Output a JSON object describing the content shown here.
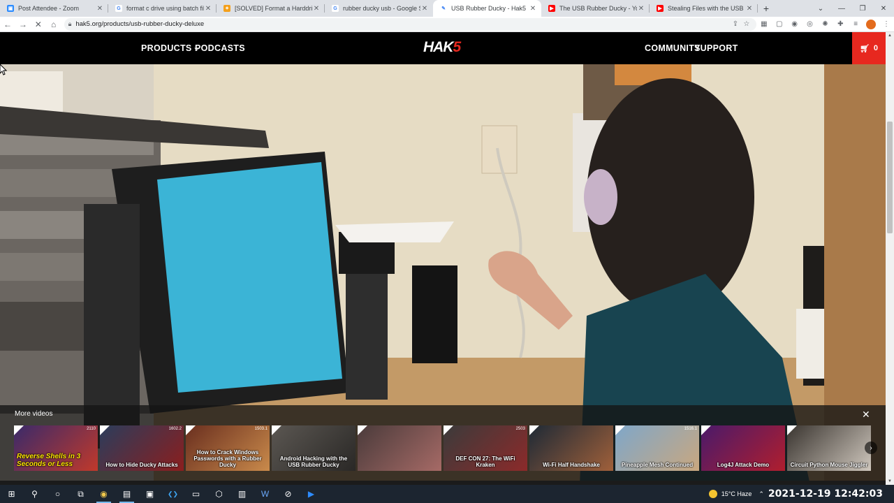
{
  "browser": {
    "tabs": [
      {
        "title": "Post Attendee - Zoom",
        "fav_color": "#2d8cff",
        "fav_glyph": "▣",
        "icon": "zoom-icon"
      },
      {
        "title": "format c drive using batch file -",
        "fav_color": "#ffffff",
        "fav_glyph": "G",
        "icon": "google-icon"
      },
      {
        "title": "[SOLVED] Format a Harddrive us",
        "fav_color": "#f4a01c",
        "fav_glyph": "✦",
        "icon": "spiceworks-icon"
      },
      {
        "title": "rubber ducky usb - Google Sear",
        "fav_color": "#ffffff",
        "fav_glyph": "G",
        "icon": "google-icon"
      },
      {
        "title": "USB Rubber Ducky - Hak5",
        "fav_color": "#ffffff",
        "fav_glyph": "✎",
        "icon": "hak5-icon",
        "active": true
      },
      {
        "title": "The USB Rubber Ducky - YouTu",
        "fav_color": "#ff0000",
        "fav_glyph": "▶",
        "icon": "youtube-icon"
      },
      {
        "title": "Stealing Files with the USB Rub",
        "fav_color": "#ff0000",
        "fav_glyph": "▶",
        "icon": "youtube-icon"
      }
    ],
    "new_tab": "+",
    "url": "hak5.org/products/usb-rubber-ducky-deluxe"
  },
  "site": {
    "nav_left": [
      "PRODUCTS",
      "PODCASTS"
    ],
    "products_caret": "⌵",
    "logo_pre": "HAK",
    "logo_num": "5",
    "nav_right": [
      "COMMUNITY",
      "SUPPORT"
    ],
    "cart_count": "0",
    "colors": {
      "accent": "#e7281f",
      "header_bg": "#000000"
    }
  },
  "more_videos": {
    "title": "More videos",
    "close": "✕",
    "items": [
      {
        "caption": "Reverse Shells in 3 Seconds or Less",
        "bg": "#3a2a6a",
        "bg2": "#c0392b",
        "num": "2110",
        "style": "big"
      },
      {
        "caption": "How to Hide Ducky Attacks",
        "bg": "#2b3d5c",
        "bg2": "#8b1e1e",
        "num": "1602.2"
      },
      {
        "caption": "How to Crack Windows Passwords with a Rubber Ducky",
        "bg": "#6a2f1f",
        "bg2": "#c98a4b",
        "num": "1503.1"
      },
      {
        "caption": "Android Hacking with the USB Rubber Ducky",
        "bg": "#5b5752",
        "bg2": "#2a2826",
        "num": ""
      },
      {
        "caption": "",
        "bg": "#4a3b3b",
        "bg2": "#a66a66",
        "num": ""
      },
      {
        "caption": "DEF CON 27: The WiFi Kraken",
        "bg": "#3b3b3b",
        "bg2": "#8c2a2a",
        "num": "2503"
      },
      {
        "caption": "Wi-Fi Half Handshake",
        "bg": "#1e2a36",
        "bg2": "#a0603a",
        "num": ""
      },
      {
        "caption": "Pineapple Mesh Continued",
        "bg": "#7fa7c9",
        "bg2": "#c9a77f",
        "num": "1516.1"
      },
      {
        "caption": "Log4J Attack Demo",
        "bg": "#4a1a6a",
        "bg2": "#b01e2e",
        "num": ""
      },
      {
        "caption": "Circuit Python Mouse Jiggler",
        "bg": "#3a3530",
        "bg2": "#cfc7bd",
        "num": ""
      }
    ]
  },
  "taskbar": {
    "weather": "15°C  Haze",
    "clock": "2021-12-19  12:42:03",
    "icons": [
      "windows-icon",
      "search-icon",
      "cortana-icon",
      "task-view-icon",
      "chrome-icon",
      "file-explorer-icon",
      "terminal-icon",
      "vscode-icon",
      "remote-desktop-icon",
      "virtualbox-icon",
      "explorer-window-icon",
      "word-icon",
      "network-icon",
      "zoom-icon"
    ]
  }
}
